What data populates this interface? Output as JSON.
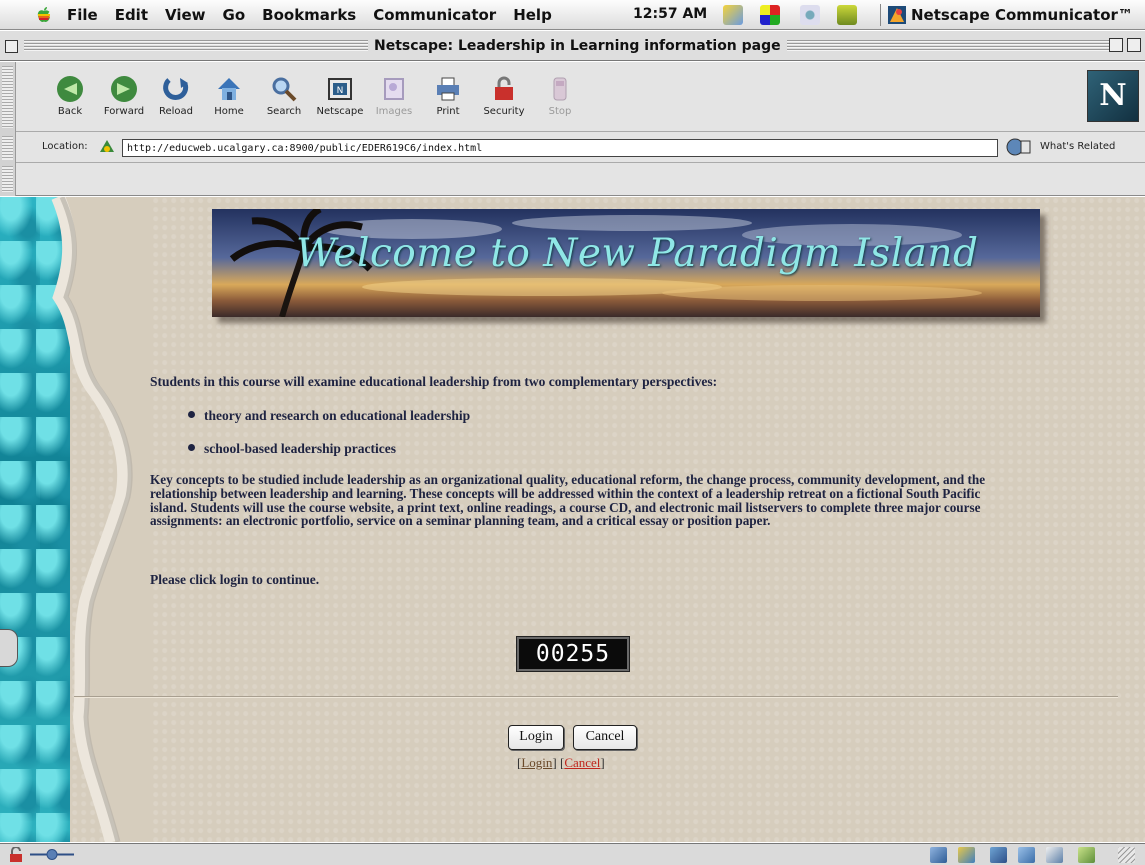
{
  "menubar": {
    "items": [
      "File",
      "Edit",
      "View",
      "Go",
      "Bookmarks",
      "Communicator",
      "Help"
    ],
    "clock": "12:57 AM",
    "app_name": "Netscape Communicator™"
  },
  "window": {
    "title": "Netscape: Leadership in Learning information page"
  },
  "toolbar": {
    "buttons": [
      {
        "label": "Back",
        "icon": "back-arrow-icon"
      },
      {
        "label": "Forward",
        "icon": "forward-arrow-icon"
      },
      {
        "label": "Reload",
        "icon": "reload-icon"
      },
      {
        "label": "Home",
        "icon": "home-icon"
      },
      {
        "label": "Search",
        "icon": "search-icon"
      },
      {
        "label": "Netscape",
        "icon": "netscape-icon"
      },
      {
        "label": "Images",
        "icon": "images-icon"
      },
      {
        "label": "Print",
        "icon": "print-icon"
      },
      {
        "label": "Security",
        "icon": "security-lock-icon"
      },
      {
        "label": "Stop",
        "icon": "stop-icon"
      }
    ],
    "brand_letter": "N"
  },
  "location": {
    "label": "Location:",
    "url": "http://educweb.ucalgary.ca:8900/public/EDER619C6/index.html",
    "related_label": "What's Related"
  },
  "page": {
    "banner_text": "Welcome to New Paradigm Island",
    "intro": "Students in this course will examine educational leadership from two complementary perspectives:",
    "bullets": [
      "theory and research on educational leadership",
      "school-based leadership practices"
    ],
    "paragraph": "Key concepts to be studied include leadership as an organizational quality, educational reform, the change process, community development, and the relationship between leadership and learning. These concepts will be addressed within the context of a leadership retreat on a fictional South Pacific island. Students will use the course website, a print text, online readings, a course CD, and electronic mail listservers to complete three major course assignments: an electronic portfolio, service on a seminar planning team, and a critical essay or position paper.",
    "click_login": "Please click login to continue.",
    "counter": "00255",
    "login_button": "Login",
    "cancel_button": "Cancel",
    "login_link": "Login",
    "cancel_link": "Cancel"
  },
  "colors": {
    "page_background": "#d6cdbd",
    "body_text": "#1e2341",
    "banner_text": "#8fe7e6",
    "cancel_link": "#c0261d",
    "water": "#2cb4c4"
  }
}
